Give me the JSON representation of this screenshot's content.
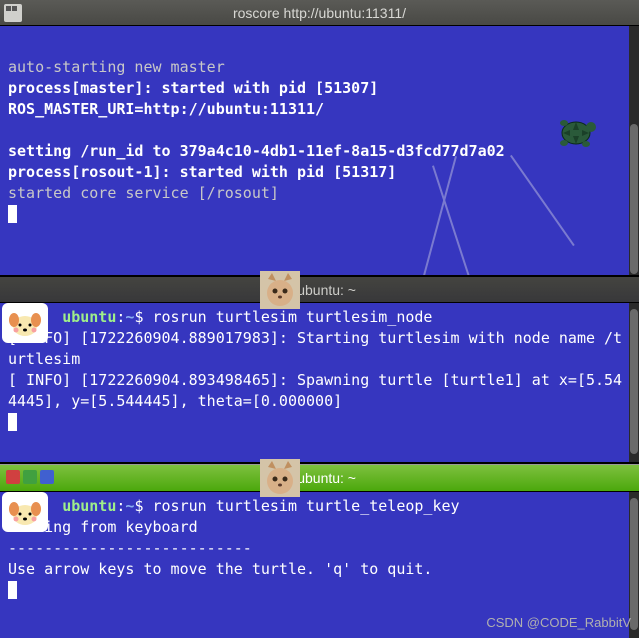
{
  "windows": {
    "roscore": {
      "title": "roscore http://ubuntu:11311/",
      "lines": {
        "autostart": "auto-starting new master",
        "process_master": "process[master]: started with pid [51307]",
        "ros_master_uri": "ROS_MASTER_URI=http://ubuntu:11311/",
        "setting_runid": "setting /run_id to 379a4c10-4db1-11ef-8a15-d3fcd77d7a02",
        "process_rosout": "process[rosout-1]: started with pid [51317]",
        "started_core": "started core service [/rosout]"
      }
    },
    "node": {
      "title": "@ubuntu: ~",
      "prompt_host": "ubuntu",
      "prompt_path": "~",
      "command": "rosrun turtlesim turtlesim_node",
      "info1": "[ INFO] [1722260904.889017983]: Starting turtlesim with node name /turtlesim",
      "info2": "[ INFO] [1722260904.893498465]: Spawning turtle [turtle1] at x=[5.544445], y=[5.544445], theta=[0.000000]"
    },
    "teleop": {
      "title": "@ubuntu: ~",
      "prompt_host": "ubuntu",
      "prompt_path": "~",
      "command": "rosrun turtlesim turtle_teleop_key",
      "reading": "Reading from keyboard",
      "dashes": "---------------------------",
      "instruct": "Use arrow keys to move the turtle. 'q' to quit."
    }
  },
  "watermark": "CSDN @CODE_RabbitV",
  "colors": {
    "terminal_bg": "#3636bf",
    "green_bar": "#4ba80c",
    "prompt_green": "#9fef8a",
    "prompt_blue": "#8ab0f0"
  }
}
